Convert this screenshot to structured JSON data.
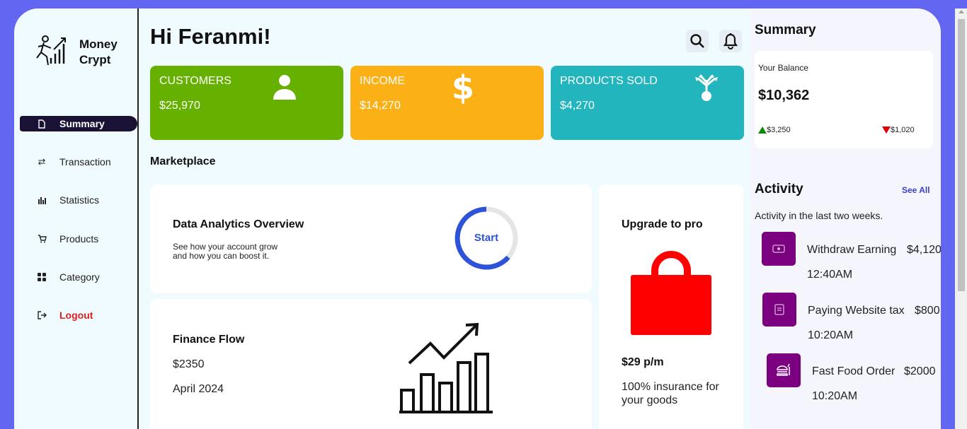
{
  "brand": {
    "name": "Money Crypt"
  },
  "sidebar": {
    "items": [
      {
        "label": "Summary",
        "icon": "file-icon",
        "active": true
      },
      {
        "label": "Transaction",
        "icon": "swap-arrows-icon"
      },
      {
        "label": "Statistics",
        "icon": "bar-chart-icon"
      },
      {
        "label": "Products",
        "icon": "cart-icon"
      },
      {
        "label": "Category",
        "icon": "grid-icon"
      },
      {
        "label": "Logout",
        "icon": "logout-icon"
      }
    ]
  },
  "header": {
    "greeting": "Hi Feranmi!"
  },
  "cards": [
    {
      "title": "CUSTOMERS",
      "value": "$25,970",
      "color": "#66b000",
      "icon": "user-icon"
    },
    {
      "title": "INCOME",
      "value": "$14,270",
      "color": "#fbb016",
      "icon": "dollar-icon"
    },
    {
      "title": "PRODUCTS SOLD",
      "value": "$4,270",
      "color": "#22b5bd",
      "icon": "plant-icon"
    }
  ],
  "marketplace": {
    "title": "Marketplace",
    "analytics": {
      "title": "Data Analytics Overview",
      "line1": "See how your account grow",
      "line2": "and how you can boost it.",
      "button": "Start"
    },
    "finance": {
      "title": "Finance Flow",
      "amount": "$2350",
      "date": "April 2024"
    },
    "upgrade": {
      "title": "Upgrade to pro",
      "price": "$29 p/m",
      "line1": "100% insurance for",
      "line2": "your goods"
    }
  },
  "summary": {
    "title": "Summary",
    "balance_label": "Your Balance",
    "balance": "$10,362",
    "up": "$3,250",
    "down": "$1,020"
  },
  "activity": {
    "title": "Activity",
    "see_all": "See All",
    "subtitle": "Activity in the last two weeks.",
    "items": [
      {
        "name": "Withdraw Earning",
        "amount": "$4,120",
        "time": "12:40AM",
        "icon": "cash-icon"
      },
      {
        "name": "Paying Website tax",
        "amount": "$800",
        "time": "10:20AM",
        "icon": "document-icon"
      },
      {
        "name": "Fast Food Order",
        "amount": "$2000",
        "time": "10:20AM",
        "icon": "burger-icon"
      }
    ]
  },
  "colors": {
    "accent": "#6366f1",
    "sidebar_active": "#1a1235",
    "activity_icon_bg": "#7a0080",
    "upgrade_bag": "#ff0000",
    "logout": "#e11d1d"
  }
}
